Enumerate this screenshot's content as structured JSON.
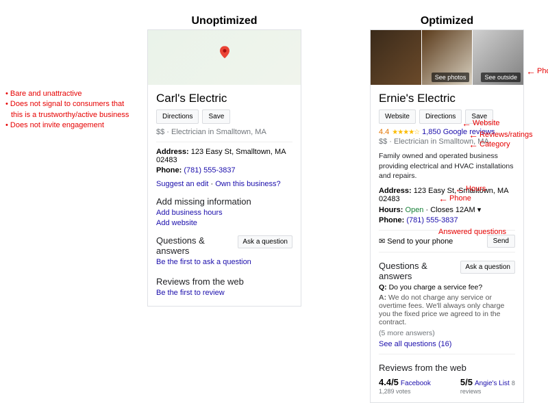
{
  "headings": {
    "left": "Unoptimized",
    "right": "Optimized"
  },
  "left": {
    "title": "Carl's Electric",
    "buttons": {
      "directions": "Directions",
      "save": "Save"
    },
    "meta": "$$ · Electrician in Smalltown, MA",
    "address_label": "Address:",
    "address": "123 Easy St, Smalltown, MA 02483",
    "phone_label": "Phone:",
    "phone": "(781) 555-3837",
    "suggest_edit": "Suggest an edit",
    "own": "Own this business?",
    "add_missing": "Add missing information",
    "add_hours": "Add business hours",
    "add_website": "Add website",
    "qa_title": "Questions & answers",
    "qa_first": "Be the first to ask a question",
    "ask_btn": "Ask a question",
    "reviews_title": "Reviews from the web",
    "reviews_first": "Be the first to review"
  },
  "right": {
    "photo_labels": {
      "see_photos": "See photos",
      "see_outside": "See outside"
    },
    "title": "Ernie's Electric",
    "buttons": {
      "website": "Website",
      "directions": "Directions",
      "save": "Save"
    },
    "rating": "4.4",
    "reviews_text": "1,850 Google reviews",
    "meta": "$$ · Electrician in Smalltown, MA",
    "desc": "Family owned and operated business providing electrical and HVAC installations and repairs.",
    "address_label": "Address:",
    "address": "123 Easy St, Smalltown, MA 02483",
    "hours_label": "Hours:",
    "hours_status": "Open",
    "hours_close": "· Closes 12AM ▾",
    "phone_label": "Phone:",
    "phone": "(781) 555-3837",
    "send_icon": "✉",
    "send_text": "Send to your phone",
    "send_btn": "Send",
    "qa_title": "Questions & answers",
    "ask_btn": "Ask a question",
    "qa_q_prefix": "Q:",
    "qa_q": "Do you charge a service fee?",
    "qa_a_prefix": "A:",
    "qa_a": "We do not charge any service or overtime fees. We'll always only charge you the fixed price we agreed to in the contract.",
    "qa_more": "(5 more answers)",
    "qa_see_all": "See all questions (16)",
    "reviews_title": "Reviews from the web",
    "web_reviews": {
      "r1_score": "4.4/5",
      "r1_src": "Facebook",
      "r1_cnt": "1,289 votes",
      "r2_score": "5/5",
      "r2_src": "Angie's List",
      "r2_cnt": "8 reviews"
    }
  },
  "bullets": {
    "b1": "• Bare and unattractive",
    "b2": "• Does not signal to consumers that",
    "b2c": "  this is a trustworthy/active business",
    "b3": "• Does not invite engagement"
  },
  "annotations": {
    "photos": "Photos",
    "website": "Website",
    "reviews": "Reviews/ratings",
    "category": "Category",
    "hours": "Hours",
    "phone": "Phone",
    "answered": "Answered questions"
  }
}
